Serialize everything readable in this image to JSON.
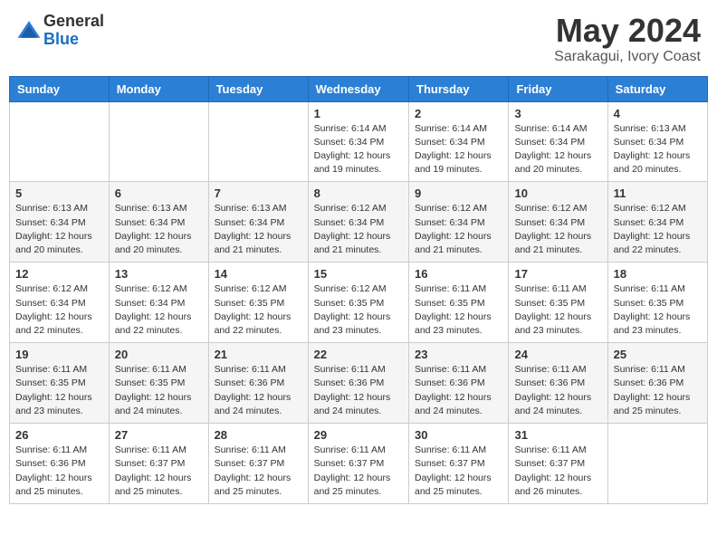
{
  "header": {
    "logo_general": "General",
    "logo_blue": "Blue",
    "title": "May 2024",
    "subtitle": "Sarakagui, Ivory Coast"
  },
  "weekdays": [
    "Sunday",
    "Monday",
    "Tuesday",
    "Wednesday",
    "Thursday",
    "Friday",
    "Saturday"
  ],
  "weeks": [
    [
      {
        "day": "",
        "info": ""
      },
      {
        "day": "",
        "info": ""
      },
      {
        "day": "",
        "info": ""
      },
      {
        "day": "1",
        "info": "Sunrise: 6:14 AM\nSunset: 6:34 PM\nDaylight: 12 hours and 19 minutes."
      },
      {
        "day": "2",
        "info": "Sunrise: 6:14 AM\nSunset: 6:34 PM\nDaylight: 12 hours and 19 minutes."
      },
      {
        "day": "3",
        "info": "Sunrise: 6:14 AM\nSunset: 6:34 PM\nDaylight: 12 hours and 20 minutes."
      },
      {
        "day": "4",
        "info": "Sunrise: 6:13 AM\nSunset: 6:34 PM\nDaylight: 12 hours and 20 minutes."
      }
    ],
    [
      {
        "day": "5",
        "info": "Sunrise: 6:13 AM\nSunset: 6:34 PM\nDaylight: 12 hours and 20 minutes."
      },
      {
        "day": "6",
        "info": "Sunrise: 6:13 AM\nSunset: 6:34 PM\nDaylight: 12 hours and 20 minutes."
      },
      {
        "day": "7",
        "info": "Sunrise: 6:13 AM\nSunset: 6:34 PM\nDaylight: 12 hours and 21 minutes."
      },
      {
        "day": "8",
        "info": "Sunrise: 6:12 AM\nSunset: 6:34 PM\nDaylight: 12 hours and 21 minutes."
      },
      {
        "day": "9",
        "info": "Sunrise: 6:12 AM\nSunset: 6:34 PM\nDaylight: 12 hours and 21 minutes."
      },
      {
        "day": "10",
        "info": "Sunrise: 6:12 AM\nSunset: 6:34 PM\nDaylight: 12 hours and 21 minutes."
      },
      {
        "day": "11",
        "info": "Sunrise: 6:12 AM\nSunset: 6:34 PM\nDaylight: 12 hours and 22 minutes."
      }
    ],
    [
      {
        "day": "12",
        "info": "Sunrise: 6:12 AM\nSunset: 6:34 PM\nDaylight: 12 hours and 22 minutes."
      },
      {
        "day": "13",
        "info": "Sunrise: 6:12 AM\nSunset: 6:34 PM\nDaylight: 12 hours and 22 minutes."
      },
      {
        "day": "14",
        "info": "Sunrise: 6:12 AM\nSunset: 6:35 PM\nDaylight: 12 hours and 22 minutes."
      },
      {
        "day": "15",
        "info": "Sunrise: 6:12 AM\nSunset: 6:35 PM\nDaylight: 12 hours and 23 minutes."
      },
      {
        "day": "16",
        "info": "Sunrise: 6:11 AM\nSunset: 6:35 PM\nDaylight: 12 hours and 23 minutes."
      },
      {
        "day": "17",
        "info": "Sunrise: 6:11 AM\nSunset: 6:35 PM\nDaylight: 12 hours and 23 minutes."
      },
      {
        "day": "18",
        "info": "Sunrise: 6:11 AM\nSunset: 6:35 PM\nDaylight: 12 hours and 23 minutes."
      }
    ],
    [
      {
        "day": "19",
        "info": "Sunrise: 6:11 AM\nSunset: 6:35 PM\nDaylight: 12 hours and 23 minutes."
      },
      {
        "day": "20",
        "info": "Sunrise: 6:11 AM\nSunset: 6:35 PM\nDaylight: 12 hours and 24 minutes."
      },
      {
        "day": "21",
        "info": "Sunrise: 6:11 AM\nSunset: 6:36 PM\nDaylight: 12 hours and 24 minutes."
      },
      {
        "day": "22",
        "info": "Sunrise: 6:11 AM\nSunset: 6:36 PM\nDaylight: 12 hours and 24 minutes."
      },
      {
        "day": "23",
        "info": "Sunrise: 6:11 AM\nSunset: 6:36 PM\nDaylight: 12 hours and 24 minutes."
      },
      {
        "day": "24",
        "info": "Sunrise: 6:11 AM\nSunset: 6:36 PM\nDaylight: 12 hours and 24 minutes."
      },
      {
        "day": "25",
        "info": "Sunrise: 6:11 AM\nSunset: 6:36 PM\nDaylight: 12 hours and 25 minutes."
      }
    ],
    [
      {
        "day": "26",
        "info": "Sunrise: 6:11 AM\nSunset: 6:36 PM\nDaylight: 12 hours and 25 minutes."
      },
      {
        "day": "27",
        "info": "Sunrise: 6:11 AM\nSunset: 6:37 PM\nDaylight: 12 hours and 25 minutes."
      },
      {
        "day": "28",
        "info": "Sunrise: 6:11 AM\nSunset: 6:37 PM\nDaylight: 12 hours and 25 minutes."
      },
      {
        "day": "29",
        "info": "Sunrise: 6:11 AM\nSunset: 6:37 PM\nDaylight: 12 hours and 25 minutes."
      },
      {
        "day": "30",
        "info": "Sunrise: 6:11 AM\nSunset: 6:37 PM\nDaylight: 12 hours and 25 minutes."
      },
      {
        "day": "31",
        "info": "Sunrise: 6:11 AM\nSunset: 6:37 PM\nDaylight: 12 hours and 26 minutes."
      },
      {
        "day": "",
        "info": ""
      }
    ]
  ]
}
